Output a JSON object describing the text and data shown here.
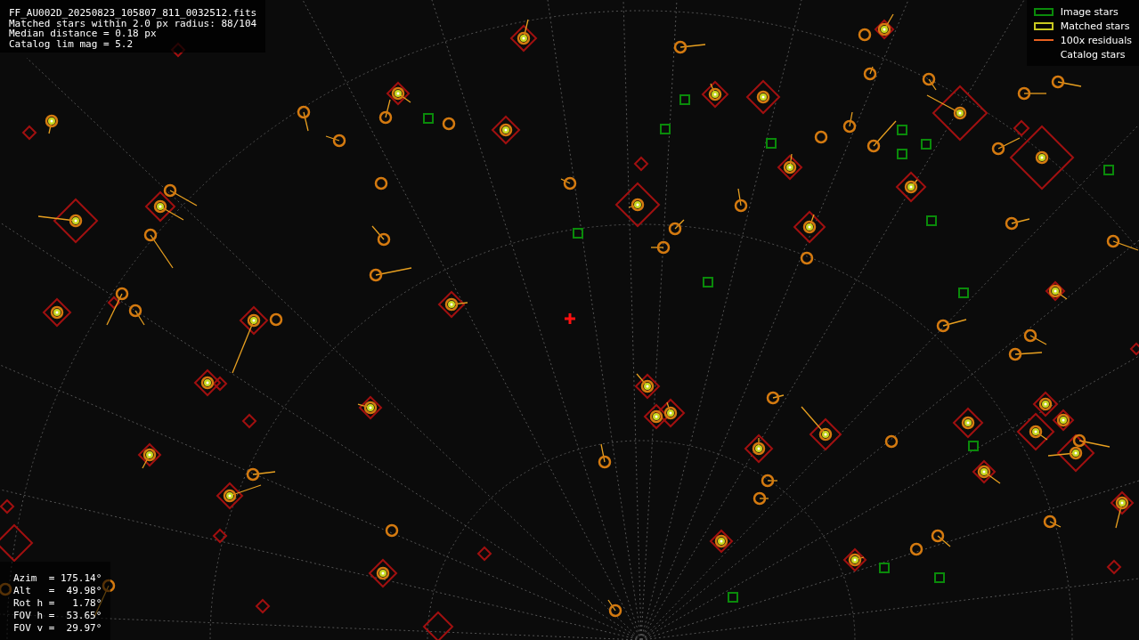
{
  "header_lines": [
    "FF_AU002D_20250823_105807_811_0032512.fits",
    "Matched stars within 2.0 px radius: 88/104",
    "Median distance = 0.18 px",
    "Catalog lim mag = 5.2"
  ],
  "legend": [
    {
      "kind": "image",
      "label": "Image stars"
    },
    {
      "kind": "matched",
      "label": "Matched stars"
    },
    {
      "kind": "residual",
      "label": "100x residuals"
    },
    {
      "kind": "catalog",
      "label": "Catalog stars"
    }
  ],
  "pointing_lines": [
    "Azim  = 175.14°",
    "Alt   =  49.98°",
    "Rot h =   1.78°",
    "FOV h =  53.65°",
    "FOV v =  29.97°"
  ]
}
